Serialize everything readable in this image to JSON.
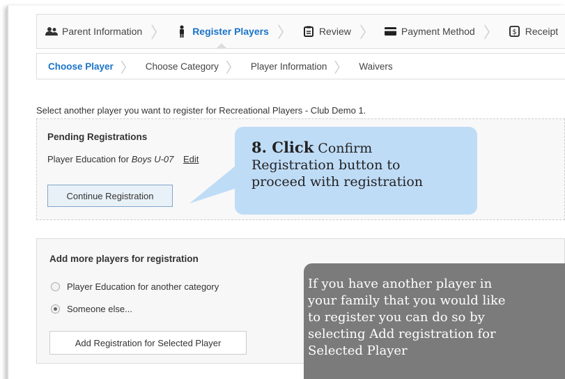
{
  "steps": [
    {
      "label": "Parent Information",
      "icon": "users-icon"
    },
    {
      "label": "Register Players",
      "icon": "person-icon",
      "active": true
    },
    {
      "label": "Review",
      "icon": "clipboard-icon"
    },
    {
      "label": "Payment Method",
      "icon": "credit-card-icon"
    },
    {
      "label": "Receipt",
      "icon": "receipt-icon"
    }
  ],
  "substeps": [
    {
      "label": "Choose Player",
      "active": true
    },
    {
      "label": "Choose Category"
    },
    {
      "label": "Player Information"
    },
    {
      "label": "Waivers"
    }
  ],
  "intro": "Select another player you want to register for Recreational Players - Club Demo 1.",
  "pending": {
    "title": "Pending Registrations",
    "item_prefix": "Player Education for ",
    "item_category": "Boys U-07",
    "edit_label": "Edit",
    "continue_label": "Continue Registration"
  },
  "add_more": {
    "title": "Add more players for registration",
    "options": [
      {
        "label": "Player Education for another category",
        "checked": false
      },
      {
        "label": "Someone else...",
        "checked": true
      }
    ],
    "button_label": "Add Registration for Selected Player"
  },
  "callout_blue": {
    "step": "8. Click",
    "line1": "Confirm",
    "line2": "Registration button to",
    "line3": "proceed with registration"
  },
  "callout_gray": {
    "line1": "If you have another player in",
    "line2": "your family that you would like",
    "line3": "to register you can do so by",
    "line4": "selecting Add registration for",
    "line5": "Selected Player"
  },
  "colors": {
    "accent": "#1a73c8",
    "callout_blue": "#bfdcf7",
    "callout_gray": "#7b7b7b"
  }
}
